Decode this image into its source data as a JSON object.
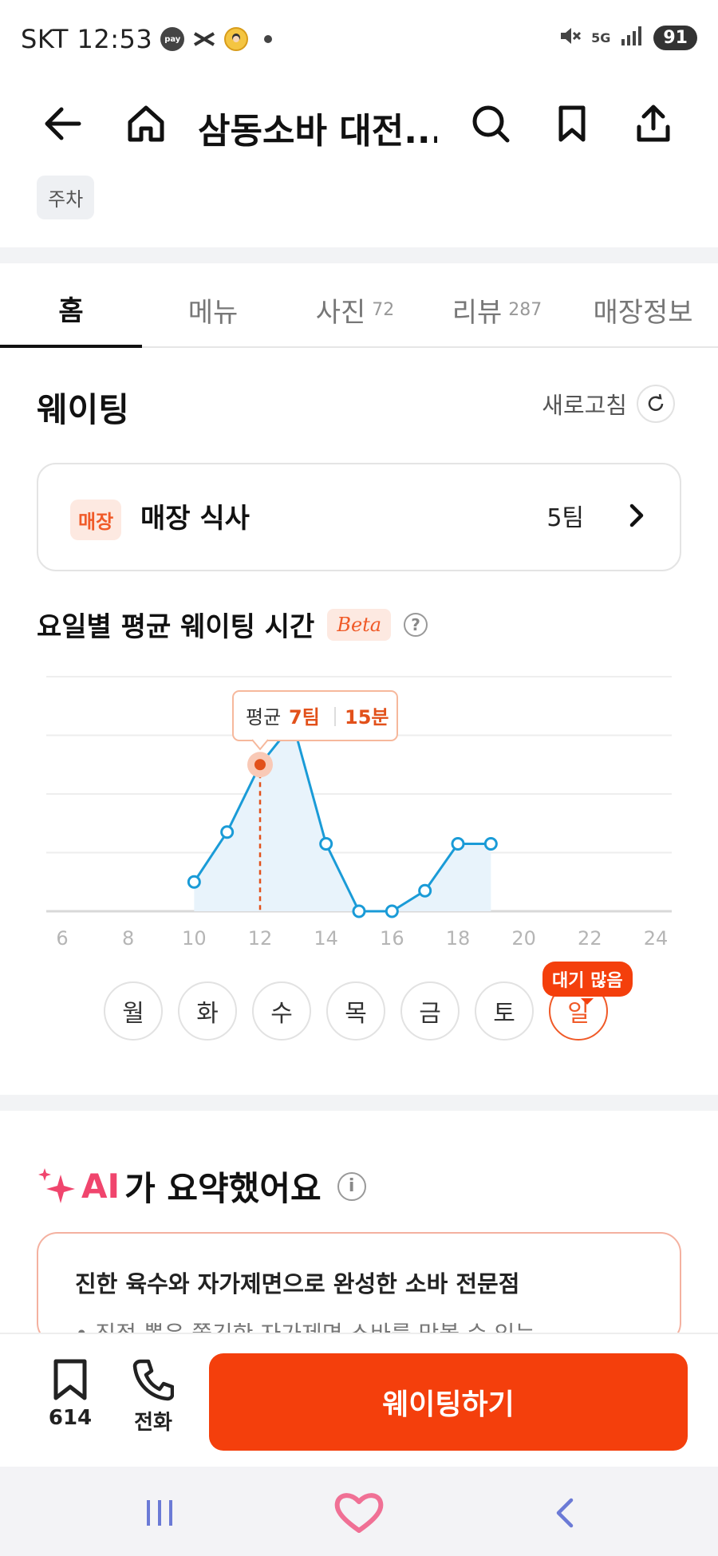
{
  "status_bar": {
    "carrier_time": "SKT 12:53",
    "network": "5G",
    "battery": "91",
    "icons": [
      "pay-icon",
      "capcut-icon",
      "avatar-icon",
      "dot-icon",
      "mute-icon",
      "signal-icon"
    ]
  },
  "header": {
    "title": "삼동소바 대전...",
    "icons": [
      "back-arrow-icon",
      "home-icon",
      "search-icon",
      "bookmark-icon",
      "share-icon"
    ]
  },
  "chip": "주차",
  "tabs": [
    {
      "label": "홈",
      "count": "",
      "active": true
    },
    {
      "label": "메뉴",
      "count": ""
    },
    {
      "label": "사진",
      "count": "72"
    },
    {
      "label": "리뷰",
      "count": "287"
    },
    {
      "label": "매장정보",
      "count": ""
    }
  ],
  "waiting": {
    "title": "웨이팅",
    "refresh_label": "새로고침",
    "card": {
      "badge": "매장",
      "label": "매장 식사",
      "count": "5팀"
    }
  },
  "chart_section": {
    "title": "요일별 평균 웨이팅 시간",
    "beta": "Beta",
    "help": "?",
    "tooltip": {
      "prefix": "평균",
      "teams": "7팀",
      "minutes": "15분"
    }
  },
  "chart_data": {
    "type": "area",
    "x_ticks": [
      "6",
      "8",
      "10",
      "12",
      "14",
      "16",
      "18",
      "20",
      "22",
      "24"
    ],
    "xlim": [
      6,
      24
    ],
    "ylim": [
      0,
      8
    ],
    "grid": true,
    "highlight_x": 12,
    "points": [
      {
        "x": 10,
        "y": 1
      },
      {
        "x": 11,
        "y": 2.7
      },
      {
        "x": 12,
        "y": 5
      },
      {
        "x": 13,
        "y": 6.4
      },
      {
        "x": 14,
        "y": 2.3
      },
      {
        "x": 15,
        "y": 0
      },
      {
        "x": 16,
        "y": 0
      },
      {
        "x": 17,
        "y": 0.7
      },
      {
        "x": 18,
        "y": 2.3
      },
      {
        "x": 19,
        "y": 2.3
      }
    ],
    "color": "#1a9bd7"
  },
  "days": [
    "월",
    "화",
    "수",
    "목",
    "금",
    "토",
    "일"
  ],
  "selected_day": "일",
  "busy_tag": "대기 많음",
  "ai": {
    "title_ai": "AI",
    "title_rest": "가 요약했어요",
    "info": "i",
    "card_title": "진한 육수와 자가제면으로 완성한 소바 전문점",
    "card_sub": "• 직접 뽑은 쫄깃한 자가제면 소바를 맛볼 수 있는"
  },
  "action_bar": {
    "bookmark_count": "614",
    "call_label": "전화",
    "wait_button": "웨이팅하기"
  },
  "nav_bar": {
    "icons": [
      "recent-apps-icon",
      "heart-home-icon",
      "back-icon"
    ]
  }
}
